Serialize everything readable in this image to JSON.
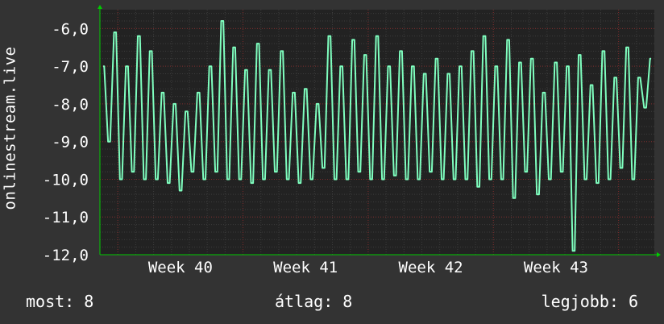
{
  "chart_data": {
    "type": "line",
    "ylabel": "onlinestream.live",
    "ylim": [
      -12.0,
      -5.5
    ],
    "yticks": [
      "-6,0",
      "-7,0",
      "-8,0",
      "-9,0",
      "-10,0",
      "-11,0",
      "-12,0"
    ],
    "ytick_values": [
      -6,
      -7,
      -8,
      -9,
      -10,
      -11,
      -12
    ],
    "xlabels": [
      "Week 40",
      "Week 41",
      "Week 42",
      "Week 43"
    ],
    "xlabel_positions_days": [
      4.5,
      11.5,
      18.5,
      25.5
    ],
    "xlim_days": [
      0,
      31
    ],
    "grid": true,
    "series": [
      {
        "color": "#7fffbf",
        "peaks": [
          -7.0,
          -6.1,
          -7.0,
          -6.2,
          -6.6,
          -7.7,
          -8.0,
          -8.2,
          -7.7,
          -7.0,
          -5.8,
          -6.5,
          -7.1,
          -6.4,
          -7.1,
          -6.6,
          -7.7,
          -7.6,
          -8.0,
          -6.2,
          -7.0,
          -6.3,
          -6.7,
          -6.2,
          -7.0,
          -6.6,
          -7.0,
          -7.2,
          -6.8,
          -7.2,
          -7.0,
          -6.6,
          -6.2,
          -7.0,
          -6.3,
          -6.9,
          -6.8,
          -7.7,
          -6.9,
          -7.0,
          -6.7,
          -7.5,
          -6.6,
          -7.3,
          -6.5,
          -7.3,
          -6.8
        ],
        "troughs": [
          -9.0,
          -10.0,
          -9.8,
          -10.0,
          -10.0,
          -10.1,
          -10.3,
          -9.8,
          -10.0,
          -9.8,
          -10.0,
          -10.0,
          -10.1,
          -10.0,
          -9.8,
          -10.0,
          -10.1,
          -10.0,
          -9.7,
          -10.0,
          -10.0,
          -9.8,
          -10.0,
          -10.0,
          -9.9,
          -10.0,
          -10.0,
          -9.8,
          -10.0,
          -10.0,
          -10.0,
          -10.2,
          -10.0,
          -10.0,
          -10.5,
          -9.8,
          -10.4,
          -10.0,
          -9.8,
          -11.9,
          -10.0,
          -10.1,
          -10.0,
          -9.7,
          -10.0,
          -8.1
        ],
        "stats": {
          "current": -8.1,
          "min": -12.0,
          "max": -5.8
        }
      }
    ]
  },
  "legend": {
    "current": "most: 8",
    "average": "átlag: 8",
    "best": "legjobb: 6"
  },
  "colors": {
    "background": "#333333",
    "plot_background": "#222222",
    "axis": "#00cc00",
    "grid_major": "#7a2a2a",
    "grid_minor": "#3c3c3c",
    "text": "#ffffff",
    "line": "#7fffbf"
  }
}
